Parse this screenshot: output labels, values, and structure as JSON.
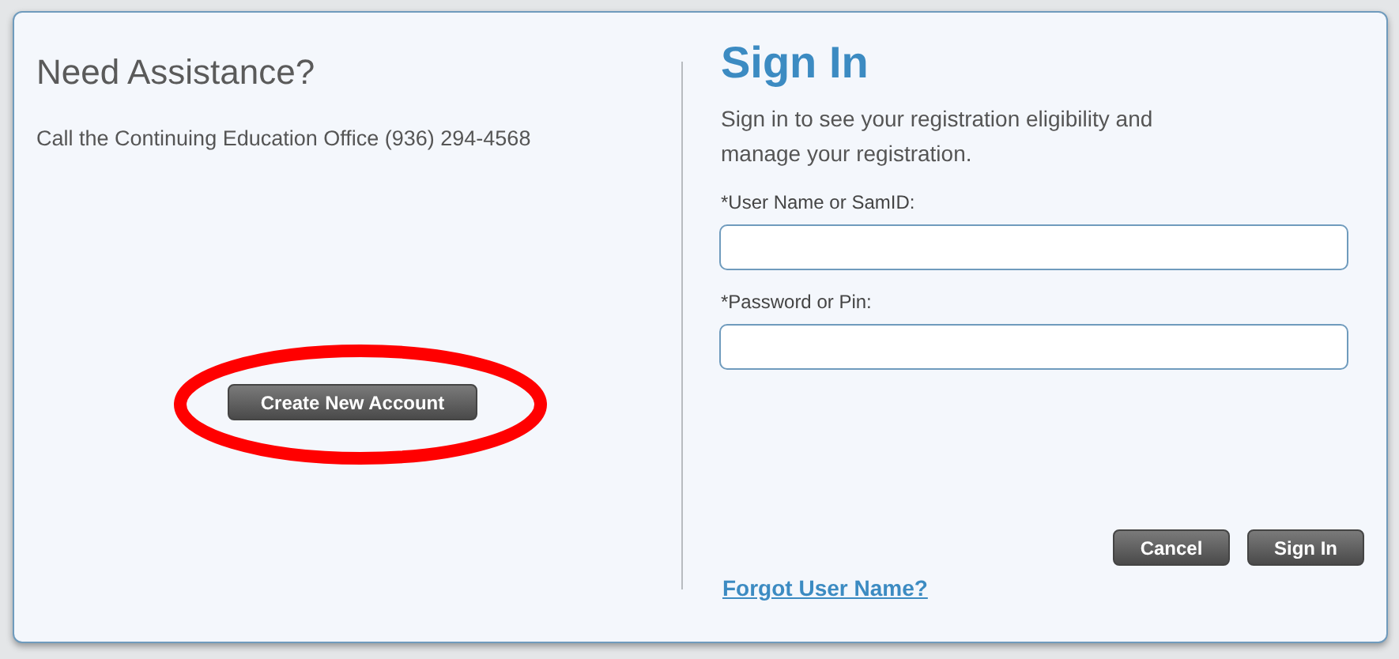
{
  "help_panel": {
    "title": "Need Assistance?",
    "message": "Call the Continuing Education Office (936) 294-4568",
    "create_account_button": "Create New Account",
    "highlighted": true
  },
  "sign_in": {
    "title": "Sign In",
    "description": "Sign in to see your registration eligibility and manage your registration.",
    "fields": [
      {
        "label": "*User Name or SamID:"
      },
      {
        "label": "*Password or Pin:"
      }
    ],
    "buttons": [
      "Cancel",
      "Sign In"
    ],
    "forgot_link": "Forgot User Name?"
  }
}
